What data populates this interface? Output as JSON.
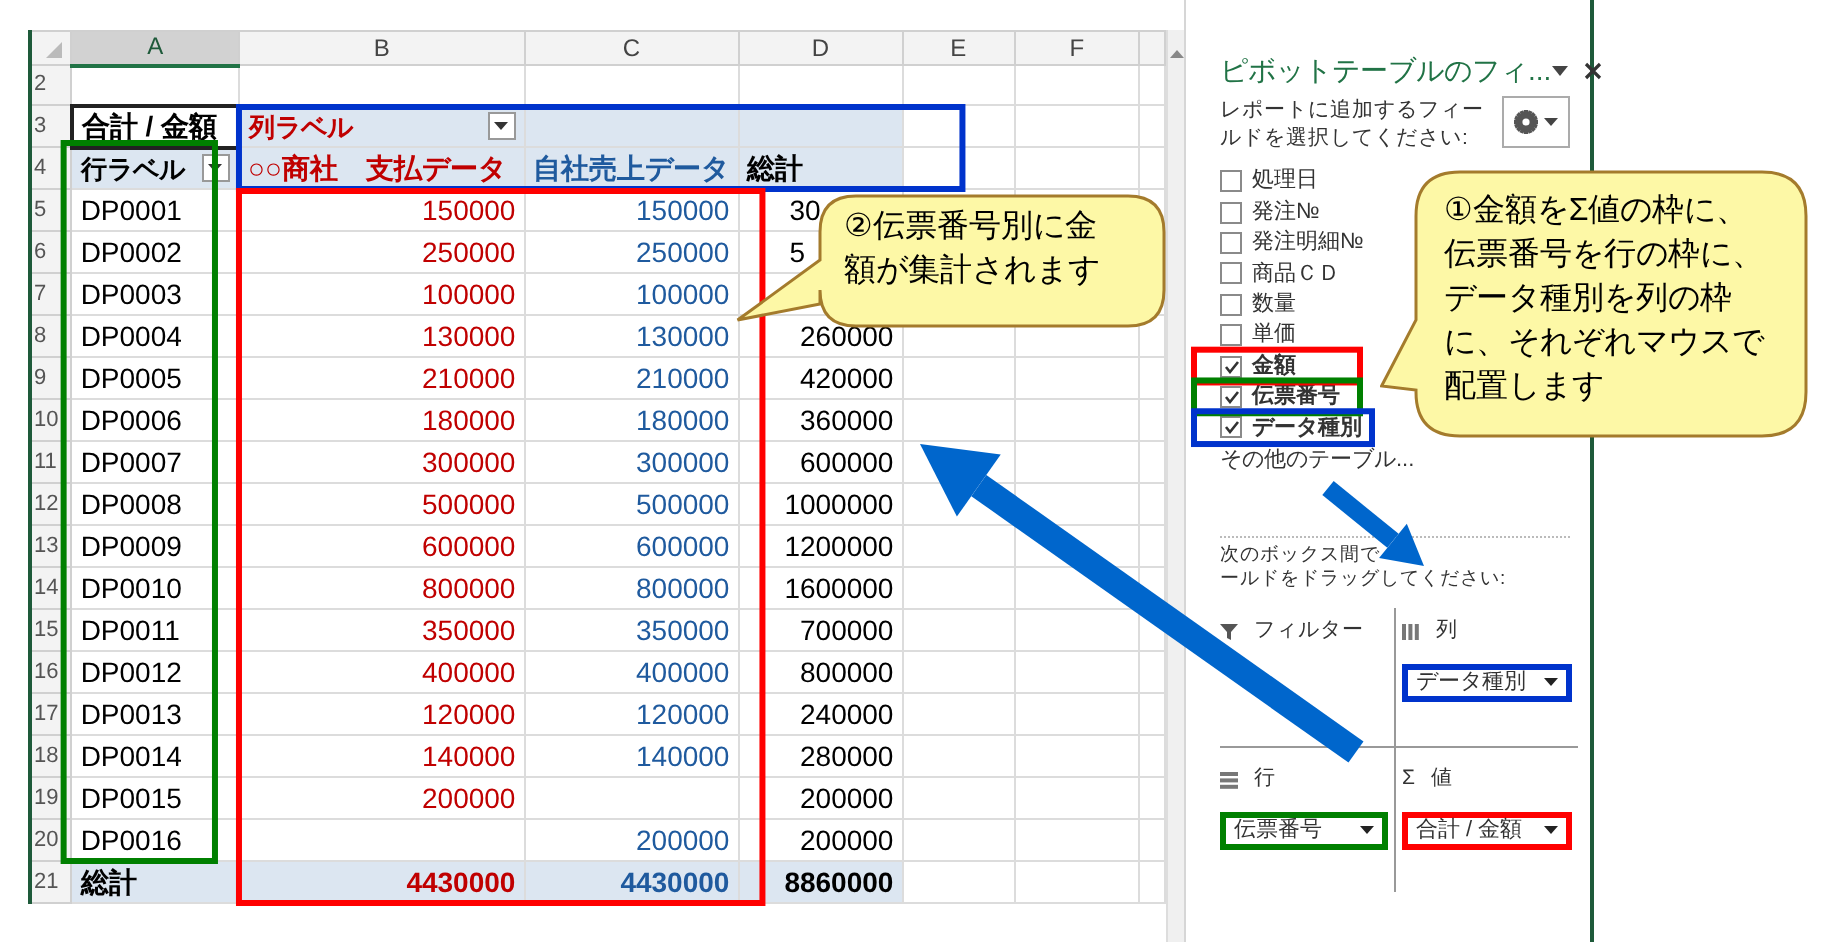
{
  "sheet": {
    "column_headers": [
      {
        "label": "A",
        "selected": true
      },
      {
        "label": "B",
        "selected": false
      },
      {
        "label": "C",
        "selected": false
      },
      {
        "label": "D",
        "selected": false
      },
      {
        "label": "E",
        "selected": false
      },
      {
        "label": "F",
        "selected": false
      }
    ],
    "row_numbers": [
      "2",
      "3",
      "4",
      "5",
      "6",
      "7",
      "8",
      "9",
      "10",
      "11",
      "12",
      "13",
      "14",
      "15",
      "16",
      "17",
      "18",
      "19",
      "20",
      "21"
    ]
  },
  "pivot": {
    "corner": "合計 / 金額",
    "column_labels": "列ラベル",
    "row_labels": "行ラベル",
    "columns": [
      {
        "label": "○○商社　支払データ",
        "color": "#c00000"
      },
      {
        "label": "自社売上データ",
        "color": "#1f5a9e"
      },
      {
        "label": "総計",
        "color": "#000000"
      }
    ],
    "rows": [
      {
        "label": "DP0001",
        "payment": "150000",
        "sales": "150000",
        "total": "30",
        "total_cut": true
      },
      {
        "label": "DP0002",
        "payment": "250000",
        "sales": "250000",
        "total": "5",
        "total_cut": true
      },
      {
        "label": "DP0003",
        "payment": "100000",
        "sales": "100000"
      },
      {
        "label": "DP0004",
        "payment": "130000",
        "sales": "130000",
        "total": "260000"
      },
      {
        "label": "DP0005",
        "payment": "210000",
        "sales": "210000",
        "total": "420000"
      },
      {
        "label": "DP0006",
        "payment": "180000",
        "sales": "180000",
        "total": "360000"
      },
      {
        "label": "DP0007",
        "payment": "300000",
        "sales": "300000",
        "total": "600000"
      },
      {
        "label": "DP0008",
        "payment": "500000",
        "sales": "500000",
        "total": "1000000"
      },
      {
        "label": "DP0009",
        "payment": "600000",
        "sales": "600000",
        "total": "1200000"
      },
      {
        "label": "DP0010",
        "payment": "800000",
        "sales": "800000",
        "total": "1600000"
      },
      {
        "label": "DP0011",
        "payment": "350000",
        "sales": "350000",
        "total": "700000"
      },
      {
        "label": "DP0012",
        "payment": "400000",
        "sales": "400000",
        "total": "800000"
      },
      {
        "label": "DP0013",
        "payment": "120000",
        "sales": "120000",
        "total": "240000"
      },
      {
        "label": "DP0014",
        "payment": "140000",
        "sales": "140000",
        "total": "280000"
      },
      {
        "label": "DP0015",
        "payment": "200000",
        "total": "200000"
      },
      {
        "label": "DP0016",
        "sales": "200000",
        "total": "200000"
      }
    ],
    "grand_total": {
      "label": "総計",
      "payment": "4430000",
      "sales": "4430000",
      "total": "8860000"
    }
  },
  "sheet_frames": [
    {
      "kind": "row_labels",
      "color": "#008000"
    },
    {
      "kind": "column_labels",
      "color": "#0033cc"
    },
    {
      "kind": "values",
      "color": "#ff0000"
    }
  ],
  "field_pane": {
    "title": "ピボットテーブルのフィ...",
    "instruction": "レポートに追加するフィールドを選択してください:",
    "fields": [
      {
        "label": "処理日",
        "checked": false
      },
      {
        "label": "発注№",
        "checked": false
      },
      {
        "label": "発注明細№",
        "checked": false
      },
      {
        "label": "商品ＣＤ",
        "checked": false
      },
      {
        "label": "数量",
        "checked": false
      },
      {
        "label": "単価",
        "checked": false
      },
      {
        "label": "金額",
        "checked": true,
        "color": "#ff0000"
      },
      {
        "label": "伝票番号",
        "checked": true,
        "color": "#008000"
      },
      {
        "label": "データ種別",
        "checked": true,
        "color": "#0033cc"
      }
    ],
    "more_tables": "その他のテーブル...",
    "drag_hint": [
      "次のボックス間で",
      "ールドをドラッグしてください:"
    ],
    "areas": [
      {
        "kind": "filter",
        "label": "フィルター"
      },
      {
        "kind": "columns",
        "label": "列",
        "items": [
          {
            "label": "データ種別",
            "color": "#0033cc"
          }
        ]
      },
      {
        "kind": "rows",
        "label": "行",
        "items": [
          {
            "label": "伝票番号",
            "color": "#008000"
          }
        ]
      },
      {
        "kind": "values",
        "icon_text": "Σ",
        "label": "値",
        "items": [
          {
            "label": "合計 / 金額",
            "color": "#ff0000"
          }
        ]
      }
    ]
  },
  "callouts": [
    {
      "text": "②伝票番号別に金額が集計されます"
    },
    {
      "text": "①金額をΣ値の枠に、伝票番号を行の枠に、データ種別を列の枠に、それぞれマウスで配置します"
    }
  ]
}
